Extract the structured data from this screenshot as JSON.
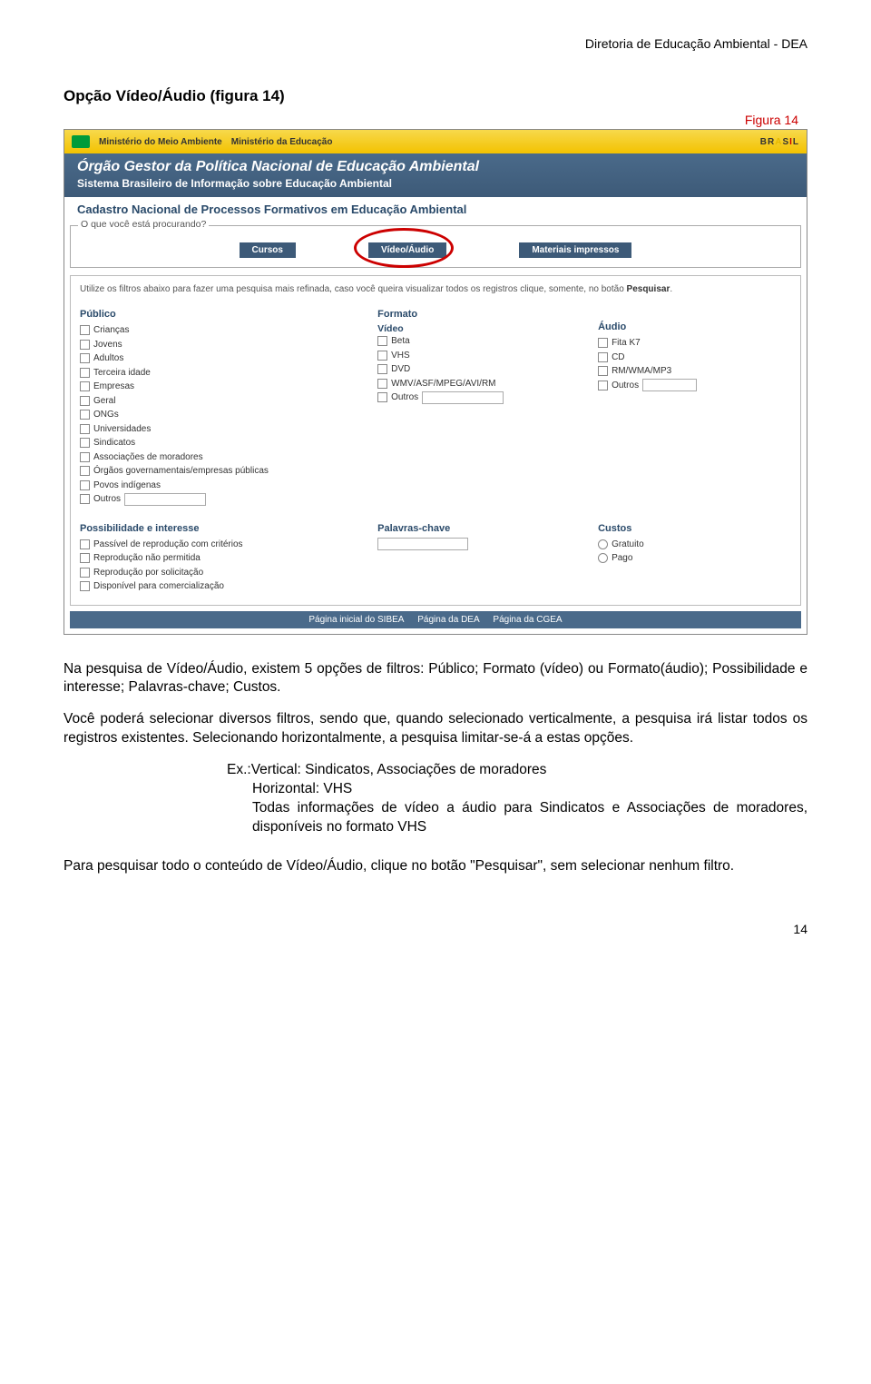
{
  "header": "Diretoria de Educação Ambiental - DEA",
  "section_title": "Opção Vídeo/Áudio (figura 14)",
  "figure_label": "Figura 14",
  "screenshot": {
    "topbar": {
      "min1": "Ministério do Meio Ambiente",
      "min2": "Ministério da Educação",
      "brasil": "BRASIL"
    },
    "banner": {
      "t1": "Órgão Gestor da Política Nacional de Educação Ambiental",
      "t2": "Sistema Brasileiro de Informação sobre Educação Ambiental"
    },
    "subtitle": "Cadastro Nacional de Processos Formativos em Educação Ambiental",
    "legend": "O que você está procurando?",
    "tabs": {
      "t1": "Cursos",
      "t2": "Vídeo/Áudio",
      "t3": "Materiais impressos"
    },
    "instr": "Utilize os filtros abaixo para fazer uma pesquisa mais refinada, caso você queira visualizar todos os registros clique, somente, no botão ",
    "instr_b": "Pesquisar",
    "publico": {
      "h": "Público",
      "items": [
        "Crianças",
        "Jovens",
        "Adultos",
        "Terceira idade",
        "Empresas",
        "Geral",
        "ONGs",
        "Universidades",
        "Sindicatos",
        "Associações de moradores",
        "Órgãos governamentais/empresas públicas",
        "Povos indígenas"
      ],
      "outros": "Outros"
    },
    "formato": {
      "h": "Formato",
      "sub": "Vídeo",
      "items": [
        "Beta",
        "VHS",
        "DVD",
        "WMV/ASF/MPEG/AVI/RM"
      ],
      "outros": "Outros"
    },
    "audio": {
      "h": "Áudio",
      "items": [
        "Fita K7",
        "CD",
        "RM/WMA/MP3"
      ],
      "outros": "Outros"
    },
    "poss": {
      "h": "Possibilidade e interesse",
      "items": [
        "Passível de reprodução com critérios",
        "Reprodução não permitida",
        "Reprodução por solicitação",
        "Disponível para comercialização"
      ]
    },
    "palavras": {
      "h": "Palavras-chave"
    },
    "custos": {
      "h": "Custos",
      "r1": "Gratuito",
      "r2": "Pago"
    },
    "footer": {
      "l1": "Página inicial do SIBEA",
      "l2": "Página da DEA",
      "l3": "Página da CGEA"
    }
  },
  "body": {
    "p1": "Na pesquisa de Vídeo/Áudio, existem 5 opções de filtros: Público; Formato (vídeo) ou Formato(áudio); Possibilidade e interesse; Palavras-chave; Custos.",
    "p2": "Você poderá selecionar diversos filtros, sendo que, quando selecionado verticalmente, a pesquisa irá listar todos os registros existentes. Selecionando horizontalmente, a pesquisa limitar-se-á a estas opções.",
    "ex1": "Ex.:Vertical: Sindicatos, Associações de moradores",
    "ex2": "Horizontal: VHS",
    "ex3": "Todas informações de vídeo a áudio para Sindicatos e Associações de moradores, disponíveis no formato VHS",
    "p3": "Para pesquisar todo o conteúdo de Vídeo/Áudio, clique no botão \"Pesquisar\", sem selecionar nenhum filtro."
  },
  "page_num": "14"
}
